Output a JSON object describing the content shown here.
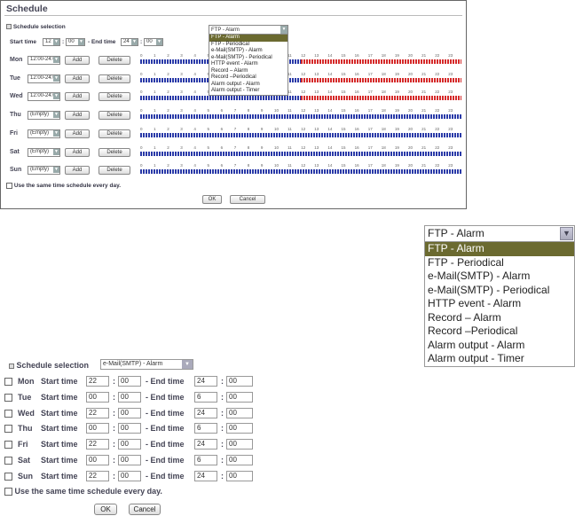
{
  "top": {
    "title": "Schedule",
    "schedule_selection": "Schedule selection",
    "start_time": "Start time",
    "start_hour": "12",
    "start_min": "00",
    "end_time": "- End time",
    "end_hour": "24",
    "end_min": "00",
    "dropdown": {
      "selected": "FTP - Alarm",
      "options": [
        "FTP - Alarm",
        "FTP - Periodical",
        "e-Mail(SMTP) - Alarm",
        "e-Mail(SMTP) - Periodical",
        "HTTP event - Alarm",
        "Record – Alarm",
        "Record –Periodical",
        "Alarm output - Alarm",
        "Alarm output - Timer"
      ]
    },
    "days": [
      {
        "name": "Mon",
        "value": "12:00-24:00",
        "red": true
      },
      {
        "name": "Tue",
        "value": "12:00-24:00",
        "red": true
      },
      {
        "name": "Wed",
        "value": "12:00-24:00",
        "red": true
      },
      {
        "name": "Thu",
        "value": "(Empty)",
        "red": false
      },
      {
        "name": "Fri",
        "value": "(Empty)",
        "red": false
      },
      {
        "name": "Sat",
        "value": "(Empty)",
        "red": false
      },
      {
        "name": "Sun",
        "value": "(Empty)",
        "red": false
      }
    ],
    "add": "Add",
    "delete": "Delete",
    "hours": [
      "0",
      "1",
      "2",
      "3",
      "4",
      "5",
      "6",
      "7",
      "8",
      "9",
      "10",
      "11",
      "12",
      "13",
      "14",
      "15",
      "16",
      "17",
      "18",
      "19",
      "20",
      "21",
      "22",
      "23"
    ],
    "same_time": "Use the same time schedule every day.",
    "ok": "OK",
    "cancel": "Cancel"
  },
  "bigdd": {
    "selected": "FTP - Alarm",
    "options": [
      "FTP - Alarm",
      "FTP - Periodical",
      "e-Mail(SMTP) - Alarm",
      "e-Mail(SMTP) - Periodical",
      "HTTP event - Alarm",
      "Record – Alarm",
      "Record –Periodical",
      "Alarm output - Alarm",
      "Alarm output - Timer"
    ]
  },
  "bottom": {
    "schedule_selection": "Schedule selection",
    "selected": "e-Mail(SMTP) - Alarm",
    "start_label": "Start time",
    "end_label": "- End time",
    "rows": [
      {
        "day": "Mon",
        "sh": "22",
        "sm": "00",
        "eh": "24",
        "em": "00"
      },
      {
        "day": "Tue",
        "sh": "00",
        "sm": "00",
        "eh": "6",
        "em": "00"
      },
      {
        "day": "Wed",
        "sh": "22",
        "sm": "00",
        "eh": "24",
        "em": "00"
      },
      {
        "day": "Thu",
        "sh": "00",
        "sm": "00",
        "eh": "6",
        "em": "00"
      },
      {
        "day": "Fri",
        "sh": "22",
        "sm": "00",
        "eh": "24",
        "em": "00"
      },
      {
        "day": "Sat",
        "sh": "00",
        "sm": "00",
        "eh": "6",
        "em": "00"
      },
      {
        "day": "Sun",
        "sh": "22",
        "sm": "00",
        "eh": "24",
        "em": "00"
      }
    ],
    "same_time": "Use the same time schedule every day.",
    "ok": "OK",
    "cancel": "Cancel"
  }
}
